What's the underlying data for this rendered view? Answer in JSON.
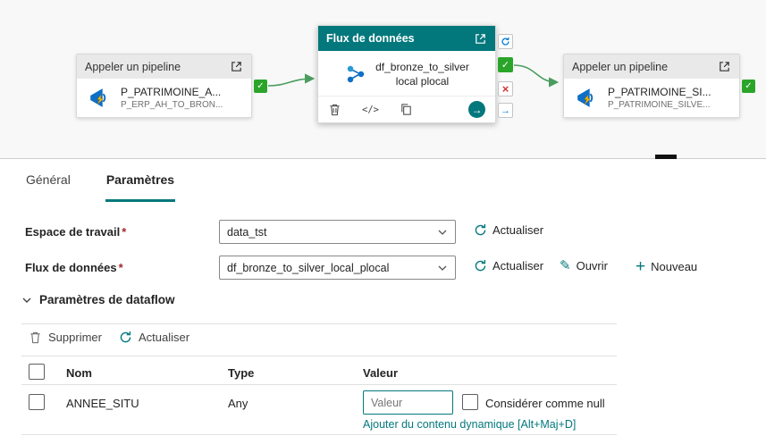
{
  "canvas": {
    "left_node": {
      "header": "Appeler un pipeline",
      "title": "P_PATRIMOINE_A...",
      "subtitle": "P_ERP_AH_TO_BRON..."
    },
    "middle_node": {
      "header": "Flux de données",
      "title_line1": "df_bronze_to_silver",
      "title_line2": "local plocal"
    },
    "right_node": {
      "header": "Appeler un pipeline",
      "title": "P_PATRIMOINE_SI...",
      "subtitle": "P_PATRIMOINE_SILVE..."
    }
  },
  "tabs": {
    "general": "Général",
    "parameters": "Paramètres"
  },
  "form": {
    "required_mark": "*",
    "workspace_label": "Espace de travail",
    "workspace_value": "data_tst",
    "dataflow_label": "Flux de données",
    "dataflow_value": "df_bronze_to_silver_local_plocal",
    "refresh_label": "Actualiser",
    "open_label": "Ouvrir",
    "new_label": "Nouveau"
  },
  "dataflow_params": {
    "section_title": "Paramètres de dataflow",
    "toolbar": {
      "delete_label": "Supprimer",
      "refresh_label": "Actualiser"
    },
    "table": {
      "headers": [
        "Nom",
        "Type",
        "Valeur"
      ],
      "rows": [
        {
          "name": "ANNEE_SITU",
          "type": "Any",
          "value_placeholder": "Valeur",
          "null_label": "Considérer comme null"
        }
      ]
    },
    "dynamic_content_link": "Ajouter du contenu dynamique [Alt+Maj+D]"
  },
  "icons": {
    "check": "✓",
    "cross": "×",
    "arrow_right": "→",
    "pencil": "✎",
    "code": "</>"
  },
  "colors": {
    "accent": "#03787c",
    "success": "#2aa52a",
    "error": "#d13438",
    "port_blue": "#0078d4",
    "connector": "#4a9d5f"
  }
}
